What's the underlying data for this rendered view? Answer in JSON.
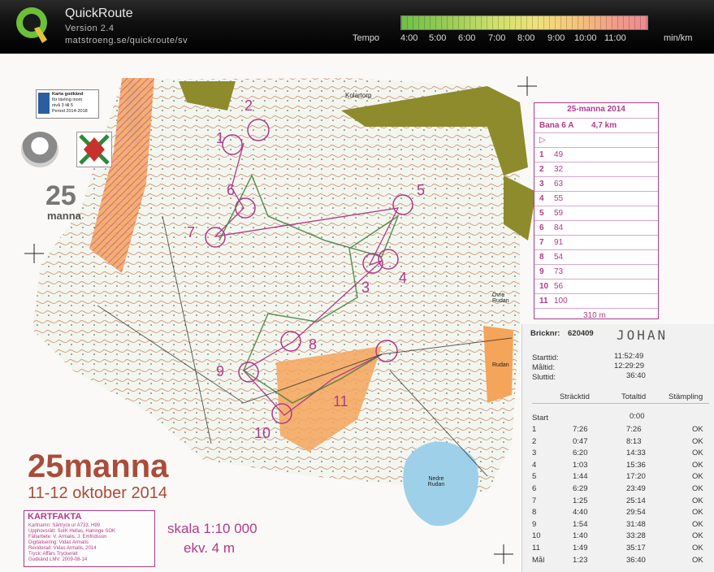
{
  "app": {
    "title": "QuickRoute",
    "version": "Version 2.4",
    "url": "matstroeng.se/quickroute/sv"
  },
  "tempo": {
    "label": "Tempo",
    "ticks": [
      "4:00",
      "5:00",
      "6:00",
      "7:00",
      "8:00",
      "9:00",
      "10:00",
      "11:00"
    ],
    "unit": "min/km"
  },
  "map": {
    "event_title": "25manna",
    "event_date": "11-12 oktober 2014",
    "scale": "skala 1:10 000",
    "equidistance": "ekv. 4 m",
    "place_kolartorp": "Kolartorp",
    "place_ovre_rudan": "Övre Rudan",
    "place_nedre_rudan": "Nedre Rudan",
    "place_rudan": "Rudan",
    "approval_badge": [
      "Karta godkänd",
      "för tävling inom",
      "nivå 3 till 5",
      "Period 2014-2018"
    ],
    "logo_25": "25",
    "logo_manna": "manna",
    "kartfakta_title": "KARTFAKTA",
    "kartfakta_lines": [
      "Kartnamn:  Särtryck ur  A733, H99",
      "Upphovsrätt:  SoIK Hellas, Haninge SOK",
      "Fältarbete:  V. Armalis, J. Emfridsson",
      "Digitalisering:  Vidas Armalis",
      "Reviderad:  Vidas Armalis, 2014",
      "Tryck:  Affärs Tryckeriet",
      "Godkänd LMV:  2009-08-14"
    ],
    "control_labels": [
      "1",
      "2",
      "3",
      "4",
      "5",
      "6",
      "7",
      "8",
      "9",
      "10",
      "11"
    ]
  },
  "control_table": {
    "title": "25-manna 2014",
    "course": "Bana 6 A",
    "length": "4,7 km",
    "rows": [
      {
        "num": "1",
        "code": "49"
      },
      {
        "num": "2",
        "code": "32"
      },
      {
        "num": "3",
        "code": "63"
      },
      {
        "num": "4",
        "code": "55"
      },
      {
        "num": "5",
        "code": "59"
      },
      {
        "num": "6",
        "code": "84"
      },
      {
        "num": "7",
        "code": "91"
      },
      {
        "num": "8",
        "code": "54"
      },
      {
        "num": "9",
        "code": "73"
      },
      {
        "num": "10",
        "code": "56"
      },
      {
        "num": "11",
        "code": "100"
      }
    ],
    "finish_distance": "310 m"
  },
  "receipt": {
    "bricknr_label": "Bricknr:",
    "bricknr": "620409",
    "name": "JOHAN",
    "starttid_label": "Starttid:",
    "starttid": "11:52:49",
    "maltid_label": "Måltid:",
    "maltid": "12:29:29",
    "sluttid_label": "Sluttid:",
    "sluttid": "36:40",
    "headers": [
      "Sträcktid",
      "Totaltid",
      "Stämpling"
    ],
    "start_label": "Start",
    "start_total": "0:00",
    "splits": [
      {
        "leg": "1",
        "split": "7:26",
        "total": "7:26",
        "status": "OK"
      },
      {
        "leg": "2",
        "split": "0:47",
        "total": "8:13",
        "status": "OK"
      },
      {
        "leg": "3",
        "split": "6:20",
        "total": "14:33",
        "status": "OK"
      },
      {
        "leg": "4",
        "split": "1:03",
        "total": "15:36",
        "status": "OK"
      },
      {
        "leg": "5",
        "split": "1:44",
        "total": "17:20",
        "status": "OK"
      },
      {
        "leg": "6",
        "split": "6:29",
        "total": "23:49",
        "status": "OK"
      },
      {
        "leg": "7",
        "split": "1:25",
        "total": "25:14",
        "status": "OK"
      },
      {
        "leg": "8",
        "split": "4:40",
        "total": "29:54",
        "status": "OK"
      },
      {
        "leg": "9",
        "split": "1:54",
        "total": "31:48",
        "status": "OK"
      },
      {
        "leg": "10",
        "split": "1:40",
        "total": "33:28",
        "status": "OK"
      },
      {
        "leg": "11",
        "split": "1:49",
        "total": "35:17",
        "status": "OK"
      },
      {
        "leg": "Mål",
        "split": "1:23",
        "total": "36:40",
        "status": "OK"
      }
    ]
  }
}
